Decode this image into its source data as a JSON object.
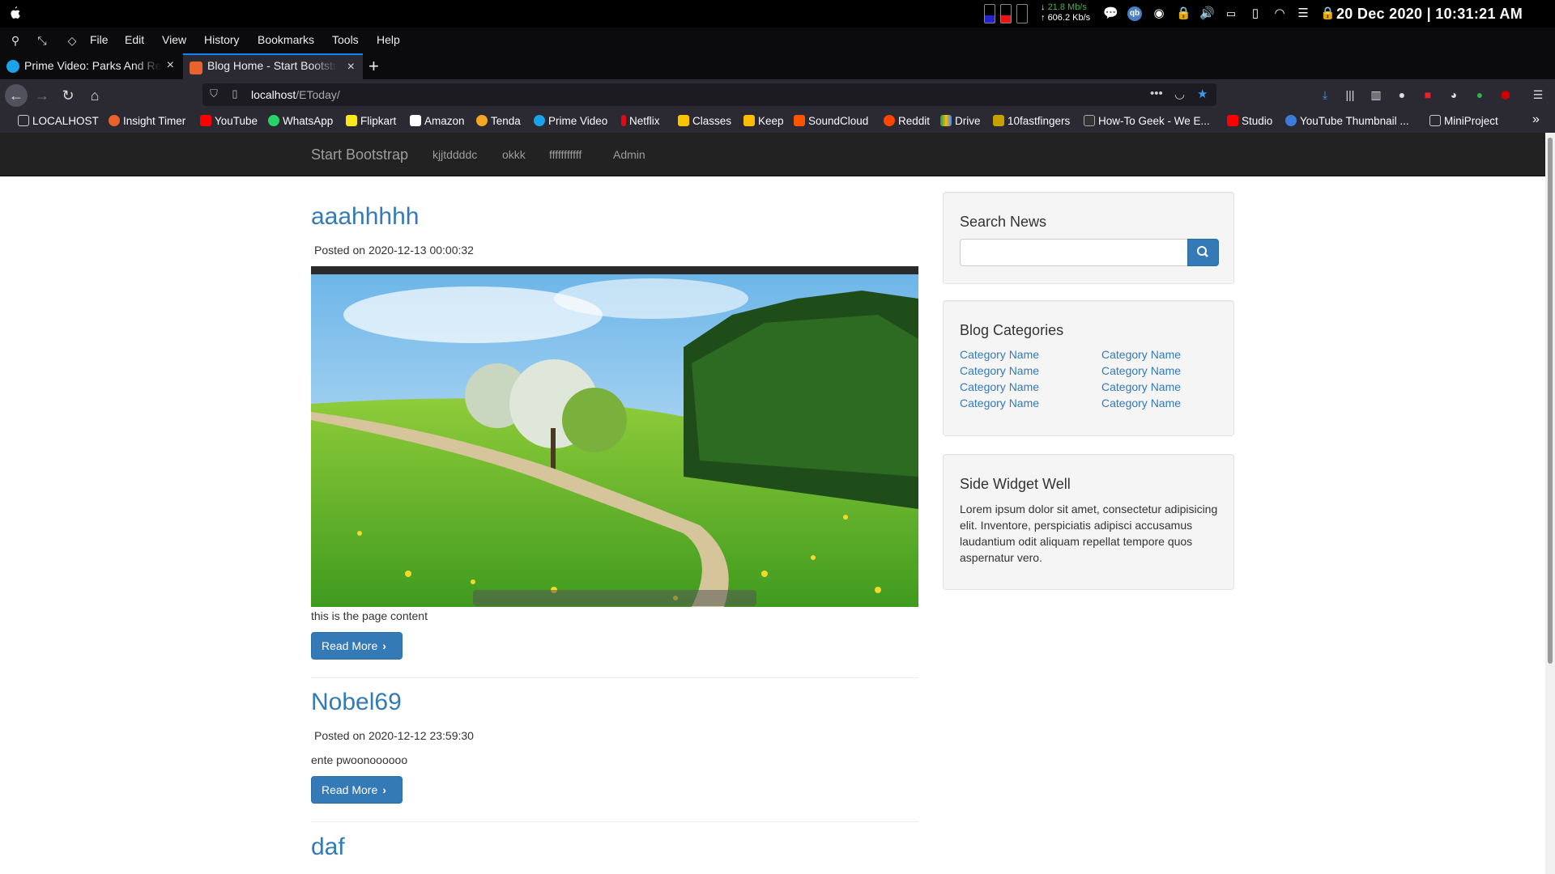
{
  "system": {
    "net_down": "21.8 Mb/s",
    "net_up": "606.2 Kb/s",
    "clock": "20 Dec 2020 | 10:31:21 AM"
  },
  "menu": [
    "File",
    "Edit",
    "View",
    "History",
    "Bookmarks",
    "Tools",
    "Help"
  ],
  "tabs": [
    {
      "label": "Prime Video: Parks And Re",
      "close": "×"
    },
    {
      "label": "Blog Home - Start Bootstr",
      "close": "×"
    }
  ],
  "new_tab": "+",
  "url": {
    "host": "localhost",
    "path": "/EToday/"
  },
  "bookmarks": [
    "LOCALHOST",
    "Insight Timer",
    "YouTube",
    "WhatsApp",
    "Flipkart",
    "Amazon",
    "Tenda",
    "Prime Video",
    "Netflix",
    "Classes",
    "Keep",
    "SoundCloud",
    "Reddit",
    "Drive",
    "10fastfingers",
    "How-To Geek - We E...",
    "Studio",
    "YouTube Thumbnail ...",
    "MiniProject"
  ],
  "site": {
    "brand": "Start Bootstrap",
    "nav": [
      "kjjtddddc",
      "okkk",
      "fffffffffff",
      "Admin"
    ]
  },
  "posts": [
    {
      "title": "aaahhhhh",
      "posted": "Posted on 2020-12-13 00:00:32",
      "content": "this is the page content",
      "read_more": "Read More"
    },
    {
      "title": "Nobel69",
      "posted": "Posted on 2020-12-12 23:59:30",
      "content": "ente pwoonoooooo",
      "read_more": "Read More"
    },
    {
      "title": "daf"
    }
  ],
  "sidebar": {
    "search_title": "Search News",
    "categories_title": "Blog Categories",
    "categories": [
      "Category Name",
      "Category Name",
      "Category Name",
      "Category Name",
      "Category Name",
      "Category Name",
      "Category Name",
      "Category Name"
    ],
    "widget_title": "Side Widget Well",
    "widget_text": "Lorem ipsum dolor sit amet, consectetur adipisicing elit. Inventore, perspiciatis adipisci accusamus laudantium odit aliquam repellat tempore quos aspernatur vero."
  },
  "colors": {
    "link": "#337ab7",
    "navbar": "#222222",
    "tab_accent": "#0a84ff"
  }
}
